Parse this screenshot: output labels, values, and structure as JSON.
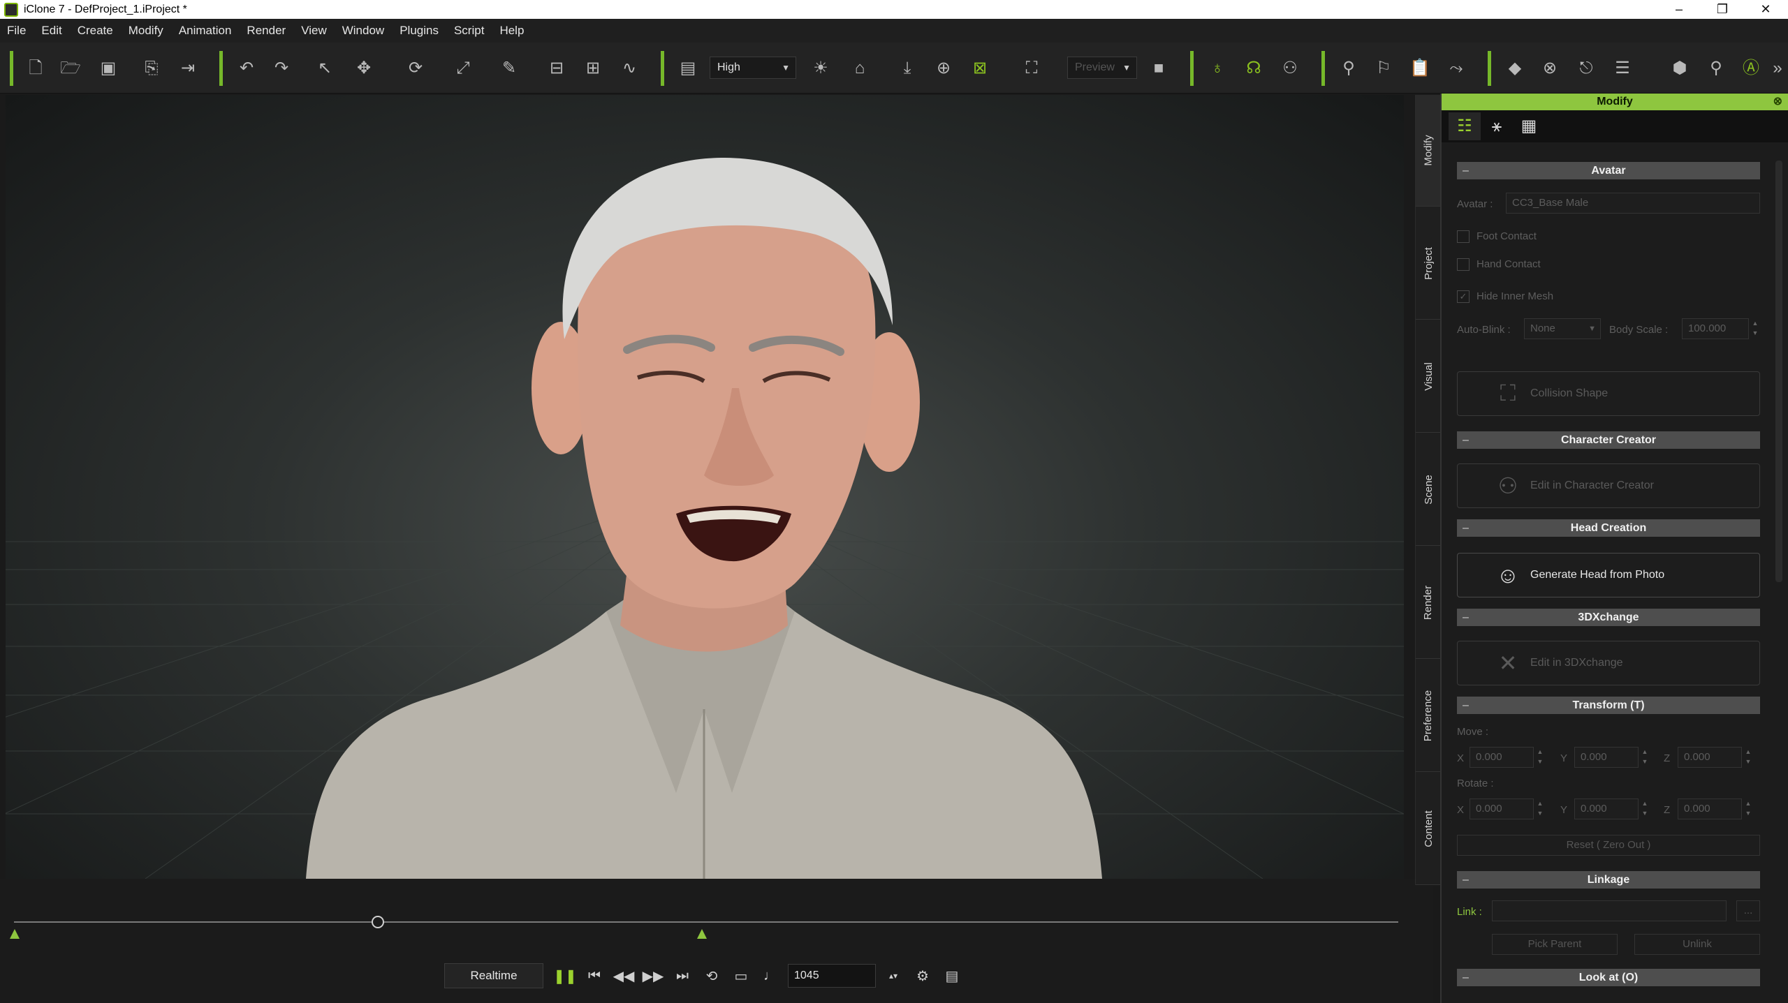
{
  "window": {
    "title": "iClone 7 - DefProject_1.iProject *",
    "controls": [
      "–",
      "❐",
      "✕"
    ]
  },
  "menu": [
    "File",
    "Edit",
    "Create",
    "Modify",
    "Animation",
    "Render",
    "View",
    "Window",
    "Plugins",
    "Script",
    "Help"
  ],
  "toolbar": {
    "quality": "High",
    "preview": "Preview"
  },
  "timeline": {
    "realtime_label": "Realtime",
    "frame": "1045"
  },
  "vertical_tabs": [
    "Modify",
    "Project",
    "Visual",
    "Scene",
    "Render",
    "Preference",
    "Content"
  ],
  "panel": {
    "title": "Modify",
    "avatar_section": {
      "header": "Avatar",
      "avatar_label": "Avatar :",
      "avatar_value": "CC3_Base Male",
      "foot_contact": "Foot Contact",
      "hand_contact": "Hand Contact",
      "hide_inner_mesh": "Hide Inner Mesh",
      "auto_blink_label": "Auto-Blink :",
      "auto_blink_value": "None",
      "body_scale_label": "Body Scale :",
      "body_scale_value": "100.000",
      "collision_shape": "Collision Shape"
    },
    "character_creator": {
      "header": "Character Creator",
      "button": "Edit in Character Creator"
    },
    "head_creation": {
      "header": "Head Creation",
      "button": "Generate Head from Photo"
    },
    "threedxchange": {
      "header": "3DXchange",
      "button": "Edit in 3DXchange"
    },
    "transform": {
      "header": "Transform  (T)",
      "move_label": "Move :",
      "rotate_label": "Rotate :",
      "x": "X",
      "y": "Y",
      "z": "Z",
      "move": [
        "0.000",
        "0.000",
        "0.000"
      ],
      "rotate": [
        "0.000",
        "0.000",
        "0.000"
      ],
      "reset": "Reset ( Zero Out )"
    },
    "linkage": {
      "header": "Linkage",
      "link_label": "Link :",
      "browse": "...",
      "pick_parent": "Pick Parent",
      "unlink": "Unlink"
    },
    "look_at": {
      "header": "Look at  (O)"
    }
  },
  "colors": {
    "accent": "#8ec63f",
    "panel_bg": "#1c1c1c",
    "section_bg": "#4e4e4e"
  }
}
